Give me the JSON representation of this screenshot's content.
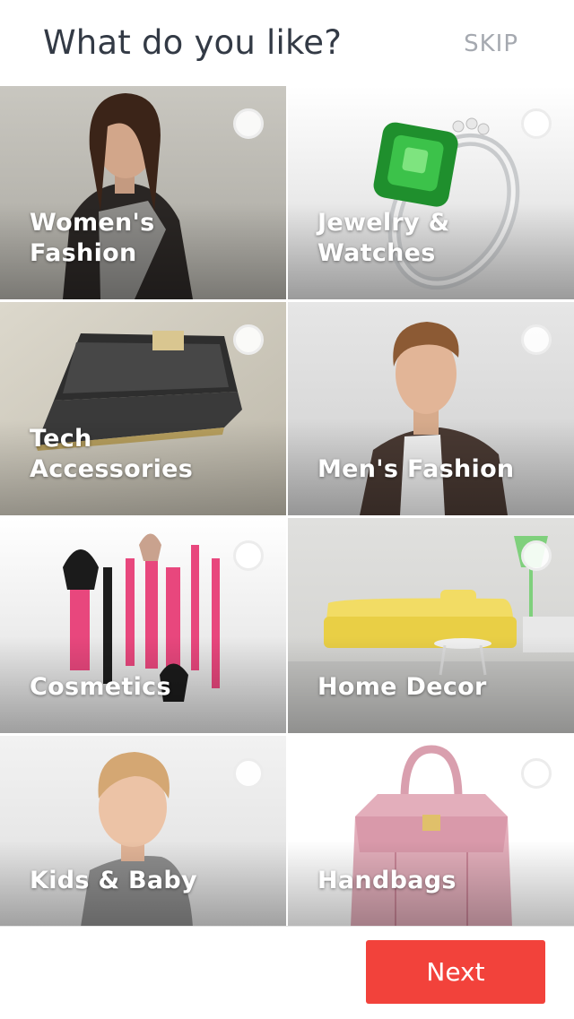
{
  "header": {
    "title": "What do you like?",
    "skip_label": "SKIP"
  },
  "categories": [
    {
      "label": "Women's Fashion",
      "icon": "woman-portrait-image",
      "selected": false
    },
    {
      "label": "Jewelry & Watches",
      "icon": "emerald-ring-image",
      "selected": false
    },
    {
      "label": "Tech Accessories",
      "icon": "phone-case-image",
      "selected": false
    },
    {
      "label": "Men's Fashion",
      "icon": "man-portrait-image",
      "selected": false
    },
    {
      "label": "Cosmetics",
      "icon": "makeup-brushes-image",
      "selected": false
    },
    {
      "label": "Home Decor",
      "icon": "yellow-sofa-image",
      "selected": false
    },
    {
      "label": "Kids & Baby",
      "icon": "child-portrait-image",
      "selected": false
    },
    {
      "label": "Handbags",
      "icon": "pink-handbag-image",
      "selected": false
    }
  ],
  "footer": {
    "next_label": "Next"
  },
  "colors": {
    "accent": "#f2423b",
    "title": "#333a45",
    "skip": "#a5a9b0"
  }
}
